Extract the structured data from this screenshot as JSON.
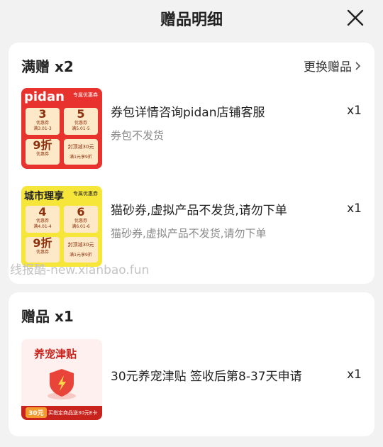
{
  "header": {
    "title": "赠品明细"
  },
  "full_gift": {
    "title": "满赠 x2",
    "swap_label": "更换赠品",
    "items": [
      {
        "name": "券包详情咨询pidan店铺客服",
        "sub": "券包不发货",
        "qty": "x1",
        "thumb": {
          "brand": "pidan",
          "tag": "专属优惠券",
          "c1_big": "3",
          "c1_small": "优惠券",
          "c1_rule": "满3.01-3",
          "c2_big": "5",
          "c2_small": "优惠券",
          "c2_rule": "满5.01-5",
          "c3_big": "9折",
          "c3_small": "优惠券",
          "c4_big": "封顶减30元",
          "c4_small": "满1元享9折"
        }
      },
      {
        "name": "猫砂券,虚拟产品不发货,请勿下单",
        "sub": "猫砂券,虚拟产品不发货,请勿下单",
        "qty": "x1",
        "thumb": {
          "brand": "城市理享",
          "tag": "专属优惠券",
          "c1_big": "4",
          "c1_small": "优惠券",
          "c1_rule": "满4.01-4",
          "c2_big": "6",
          "c2_small": "优惠券",
          "c2_rule": "满6.01-6",
          "c3_big": "9折",
          "c3_small": "优惠券",
          "c4_big": "封顶减30元",
          "c4_small": "满1元享9折"
        }
      }
    ]
  },
  "watermark": "线报酷-new.xianbao.fun",
  "gift": {
    "title": "赠品 x1",
    "item": {
      "name": "30元养宠津贴 签收后第8-37天申请",
      "qty": "x1",
      "thumb": {
        "title": "养宠津贴",
        "pill": "30元",
        "note": "买指定商品送30元E卡"
      }
    }
  },
  "colors": {
    "red": "#e8322d",
    "yellow": "#f7e63a",
    "coupon": "#fde9c8"
  }
}
